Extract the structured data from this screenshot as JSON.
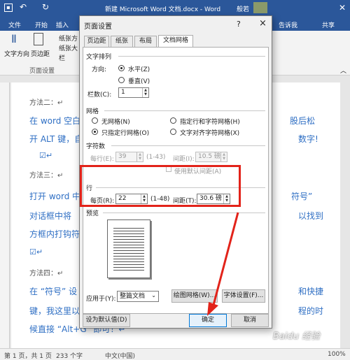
{
  "word": {
    "title": "新建 Microsoft Word 文档.docx - Word",
    "user": "般若",
    "tabs": [
      "文件",
      "开始",
      "插入",
      "告诉我",
      "共享"
    ],
    "ribbon": {
      "text_direction": "文字方向",
      "margins": "页边距",
      "paper_direction": "纸张方",
      "paper_size": "纸张大",
      "columns": "栏",
      "group_label": "页面设置"
    },
    "doc": {
      "line1": "方法二：↵",
      "line2a": "在 word 空白",
      "line2b": "股后松",
      "line3a": "开 ALT 键，自",
      "line3b": "数字!",
      "check1": "☑↵",
      "line4": "方法三：↵",
      "line5a": "打开 word 中",
      "line5b": "符号”",
      "line6a": "对话框中将",
      "line6b": "以找到",
      "line7a": "方框内打钩符",
      "check2": "☑↵",
      "line8": "方法四：↵",
      "line9a": "在 “符号” 设",
      "line9b": "和快捷",
      "line10a": "键，我这里以",
      "line10b": "程的时",
      "line11": "候直接 “Alt+G” 即可！↵"
    },
    "status": {
      "page": "第 1 页，共 1 页",
      "words": "233 个字",
      "lang": "中文(中国)",
      "zoom": "100%"
    },
    "watermark": "Baidu 经验"
  },
  "dialog": {
    "title": "页面设置",
    "help": "?",
    "close": "×",
    "tabs": [
      "页边距",
      "纸张",
      "布局",
      "文档网格"
    ],
    "text_layout": {
      "label": "文字排列",
      "direction_label": "方向:",
      "horizontal": "水平(Z)",
      "vertical": "垂直(V)",
      "columns_label": "栏数(C):",
      "columns_value": "1"
    },
    "grid": {
      "label": "网格",
      "none": "无网格(N)",
      "rows_and_chars": "指定行和字符网格(H)",
      "rows_only": "只指定行网格(O)",
      "align_chars": "文字对齐字符网格(X)"
    },
    "chars": {
      "label": "字符数",
      "per_line_label": "每行(E):",
      "per_line_value": "39",
      "per_line_range": "(1-43)",
      "spacing_label": "间距(I):",
      "spacing_value": "10.5 磅",
      "default_label": "使用默认间距(A)"
    },
    "lines": {
      "label": "行",
      "per_page_label": "每页(R):",
      "per_page_value": "22",
      "per_page_range": "(1-48)",
      "spacing_label": "间距(T):",
      "spacing_value": "30.6 磅"
    },
    "preview": {
      "label": "预览"
    },
    "apply": {
      "label": "应用于(Y):",
      "value": "整篇文档"
    },
    "buttons": {
      "draw_grid": "绘图网格(W)...",
      "font_settings": "字体设置(F)...",
      "set_default": "设为默认值(D)",
      "ok": "确定",
      "cancel": "取消"
    }
  }
}
